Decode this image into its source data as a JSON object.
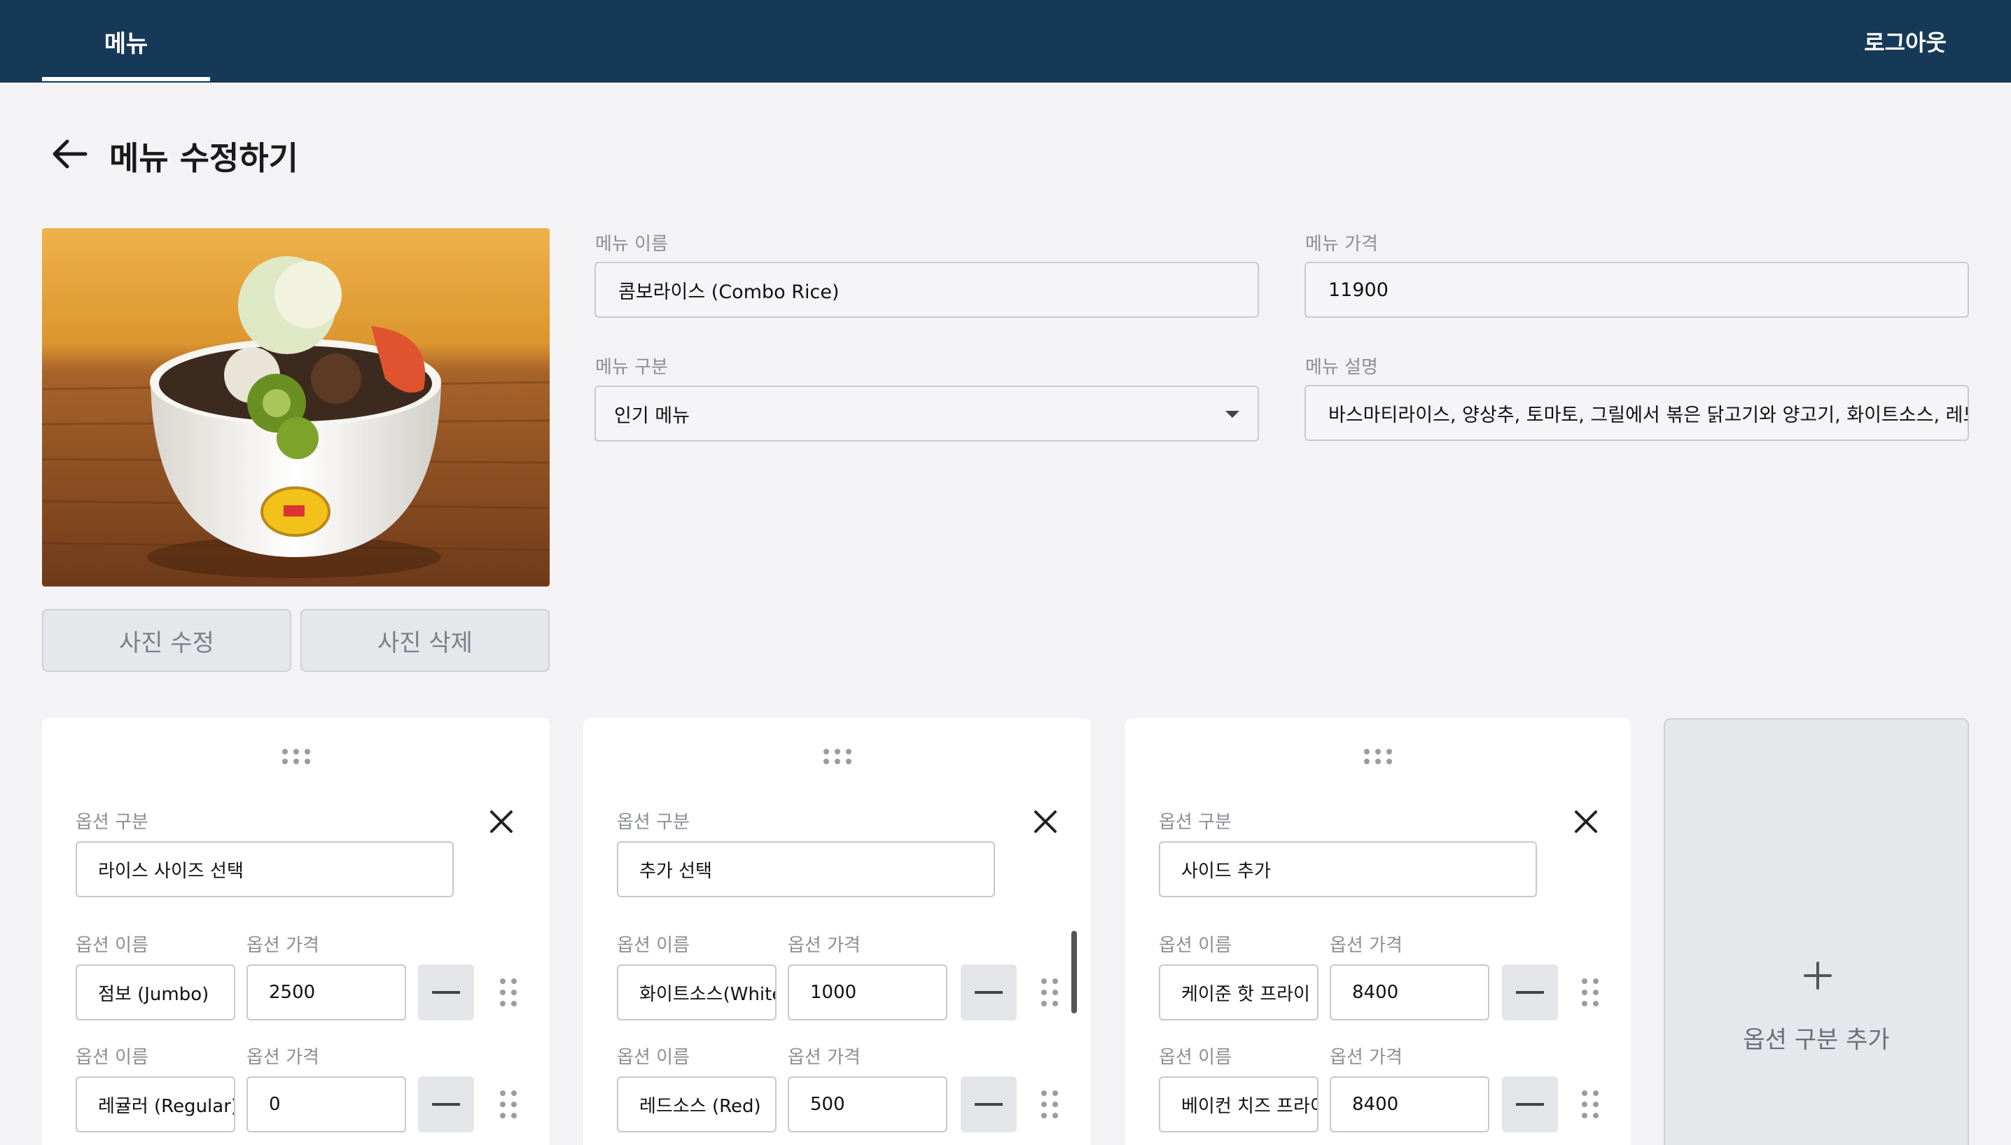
{
  "topbar": {
    "menu_tab": "메뉴",
    "logout": "로그아웃"
  },
  "page": {
    "title": "메뉴 수정하기"
  },
  "photo": {
    "edit_label": "사진 수정",
    "delete_label": "사진 삭제"
  },
  "form": {
    "name_label": "메뉴 이름",
    "name_value": "콤보라이스 (Combo Rice)",
    "price_label": "메뉴 가격",
    "price_value": "11900",
    "category_label": "메뉴 구분",
    "category_value": "인기 메뉴",
    "description_label": "메뉴 설명",
    "description_value": "바스마티라이스, 양상추, 토마토, 그릴에서 볶은 닭고기와 양고기, 화이트소스, 레드소스"
  },
  "option_groups": [
    {
      "group_label": "옵션 구분",
      "group_value": "라이스 사이즈 선택",
      "items": [
        {
          "name_label": "옵션 이름",
          "price_label": "옵션 가격",
          "name": "점보 (Jumbo)",
          "price": "2500"
        },
        {
          "name_label": "옵션 이름",
          "price_label": "옵션 가격",
          "name": "레귤러 (Regular)",
          "price": "0"
        }
      ]
    },
    {
      "group_label": "옵션 구분",
      "group_value": "추가 선택",
      "items": [
        {
          "name_label": "옵션 이름",
          "price_label": "옵션 가격",
          "name": "화이트소스(White)",
          "price": "1000"
        },
        {
          "name_label": "옵션 이름",
          "price_label": "옵션 가격",
          "name": "레드소스 (Red)",
          "price": "500"
        }
      ]
    },
    {
      "group_label": "옵션 구분",
      "group_value": "사이드 추가",
      "items": [
        {
          "name_label": "옵션 이름",
          "price_label": "옵션 가격",
          "name": "케이준 핫 프라이",
          "price": "8400"
        },
        {
          "name_label": "옵션 이름",
          "price_label": "옵션 가격",
          "name": "베이컨 치즈 프라이",
          "price": "8400"
        }
      ]
    }
  ],
  "add_group": {
    "label": "옵션 구분 추가"
  },
  "icons": {
    "back": "arrow-left-icon",
    "close": "close-icon",
    "drag": "drag-handle-icon",
    "remove": "minus-icon",
    "add": "plus-icon",
    "select": "caret-down-icon"
  }
}
